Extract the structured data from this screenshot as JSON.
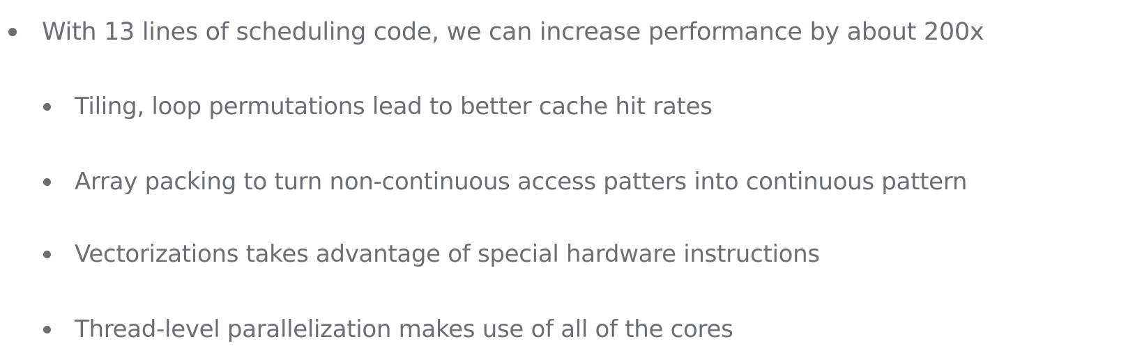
{
  "slide": {
    "main_bullet": "With 13 lines of scheduling code, we can increase performance by about 200x",
    "sub_bullets": [
      "Tiling, loop permutations lead to better cache hit rates",
      "Array packing to turn non-continuous access patters into continuous pattern",
      "Vectorizations takes advantage of special hardware instructions",
      "Thread-level parallelization makes use of all of the cores"
    ]
  },
  "colors": {
    "text": "#6b6e72",
    "background": "#ffffff"
  },
  "icons": {
    "bullet": "bullet-dot-icon"
  }
}
